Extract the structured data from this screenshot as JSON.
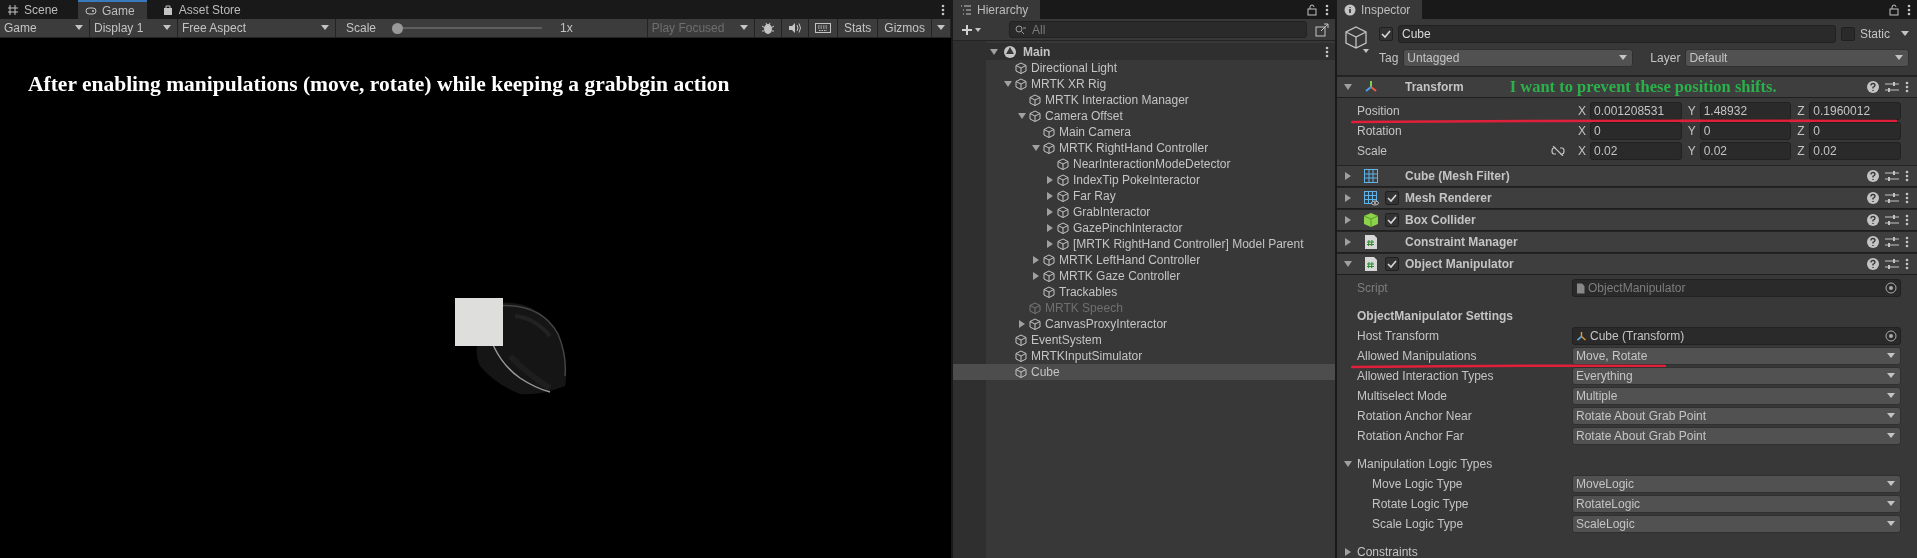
{
  "game_panel": {
    "tabs": [
      {
        "label": "Scene",
        "kind": "scene",
        "selected": false
      },
      {
        "label": "Game",
        "kind": "game",
        "selected": true
      },
      {
        "label": "Asset Store",
        "kind": "store",
        "selected": false
      }
    ],
    "toolbar": {
      "view_mode": "Game",
      "display": "Display 1",
      "aspect": "Free Aspect",
      "scale_label": "Scale",
      "scale_slider": {
        "level": 0
      },
      "scale_value": "1x",
      "play_mode": "Play Focused",
      "stats": "Stats",
      "gizmos": "Gizmos"
    },
    "annotation": "After enabling manipulations (move, rotate) while keeping a grabbgin action"
  },
  "hierarchy": {
    "title": "Hierarchy",
    "search_placeholder": "All",
    "scene": {
      "name": "Main",
      "expanded": true,
      "children": [
        {
          "name": "Directional Light",
          "selected": false,
          "inactive": false
        },
        {
          "name": "MRTK XR Rig",
          "expanded": true,
          "selected": false,
          "inactive": false,
          "children": [
            {
              "name": "MRTK Interaction Manager",
              "selected": false,
              "inactive": false
            },
            {
              "name": "Camera Offset",
              "expanded": true,
              "selected": false,
              "inactive": false,
              "children": [
                {
                  "name": "Main Camera",
                  "selected": false,
                  "inactive": false
                },
                {
                  "name": "MRTK RightHand Controller",
                  "expanded": true,
                  "selected": false,
                  "inactive": false,
                  "children": [
                    {
                      "name": "NearInteractionModeDetector",
                      "selected": false,
                      "inactive": false
                    },
                    {
                      "name": "IndexTip PokeInteractor",
                      "expanded": false,
                      "selected": false,
                      "inactive": false
                    },
                    {
                      "name": "Far Ray",
                      "expanded": false,
                      "selected": false,
                      "inactive": false
                    },
                    {
                      "name": "GrabInteractor",
                      "expanded": false,
                      "selected": false,
                      "inactive": false
                    },
                    {
                      "name": "GazePinchInteractor",
                      "expanded": false,
                      "selected": false,
                      "inactive": false
                    },
                    {
                      "name": "[MRTK RightHand Controller] Model Parent",
                      "expanded": false,
                      "selected": false,
                      "inactive": false
                    }
                  ]
                },
                {
                  "name": "MRTK LeftHand Controller",
                  "expanded": false,
                  "selected": false,
                  "inactive": false
                },
                {
                  "name": "MRTK Gaze Controller",
                  "expanded": false,
                  "selected": false,
                  "inactive": false
                },
                {
                  "name": "Trackables",
                  "selected": false,
                  "inactive": false
                }
              ]
            },
            {
              "name": "MRTK Speech",
              "selected": false,
              "inactive": true
            },
            {
              "name": "CanvasProxyInteractor",
              "expanded": false,
              "selected": false,
              "inactive": false
            }
          ]
        },
        {
          "name": "EventSystem",
          "selected": false,
          "inactive": false
        },
        {
          "name": "MRTKInputSimulator",
          "selected": false,
          "inactive": false
        },
        {
          "name": "Cube",
          "selected": true,
          "inactive": false
        }
      ]
    }
  },
  "inspector": {
    "title": "Inspector",
    "object": {
      "active": true,
      "name": "Cube",
      "static": false,
      "static_label": "Static",
      "tag_label": "Tag",
      "tag": "Untagged",
      "layer_label": "Layer",
      "layer": "Default"
    },
    "components": [
      {
        "kind": "transform",
        "name": "Transform",
        "expanded": true,
        "note": "I want to prevent these position shifts.",
        "rows": [
          {
            "label": "Position",
            "underlined": true,
            "values": [
              {
                "axis": "X",
                "value": "0.001208531"
              },
              {
                "axis": "Y",
                "value": "1.48932"
              },
              {
                "axis": "Z",
                "value": "0.1960012"
              }
            ]
          },
          {
            "label": "Rotation",
            "values": [
              {
                "axis": "X",
                "value": "0"
              },
              {
                "axis": "Y",
                "value": "0"
              },
              {
                "axis": "Z",
                "value": "0"
              }
            ]
          },
          {
            "label": "Scale",
            "constrain_icon": true,
            "values": [
              {
                "axis": "X",
                "value": "0.02"
              },
              {
                "axis": "Y",
                "value": "0.02"
              },
              {
                "axis": "Z",
                "value": "0.02"
              }
            ]
          }
        ]
      },
      {
        "kind": "mesh_filter",
        "name": "Cube (Mesh Filter)",
        "expanded": false
      },
      {
        "kind": "mesh_renderer",
        "name": "Mesh Renderer",
        "expanded": false,
        "enabled": true
      },
      {
        "kind": "box_collider",
        "name": "Box Collider",
        "expanded": false,
        "enabled": true
      },
      {
        "kind": "script",
        "name": "Constraint Manager",
        "expanded": false
      },
      {
        "kind": "script",
        "name": "Object Manipulator",
        "expanded": true,
        "enabled": true,
        "fields": [
          {
            "kind": "script",
            "label": "Script",
            "value": "ObjectManipulator"
          },
          {
            "kind": "header",
            "label": "ObjectManipulator Settings"
          },
          {
            "kind": "object",
            "label": "Host Transform",
            "value": "Cube (Transform)"
          },
          {
            "kind": "dropdown",
            "label": "Allowed Manipulations",
            "value": "Move, Rotate",
            "underlined": true
          },
          {
            "kind": "dropdown",
            "label": "Allowed Interaction Types",
            "value": "Everything"
          },
          {
            "kind": "dropdown",
            "label": "Multiselect Mode",
            "value": "Multiple"
          },
          {
            "kind": "dropdown",
            "label": "Rotation Anchor Near",
            "value": "Rotate About Grab Point"
          },
          {
            "kind": "dropdown",
            "label": "Rotation Anchor Far",
            "value": "Rotate About Grab Point"
          },
          {
            "kind": "foldout",
            "label": "Manipulation Logic Types",
            "expanded": true,
            "children": [
              {
                "kind": "dropdown",
                "label": "Move Logic Type",
                "value": "MoveLogic"
              },
              {
                "kind": "dropdown",
                "label": "Rotate Logic Type",
                "value": "RotateLogic"
              },
              {
                "kind": "dropdown",
                "label": "Scale Logic Type",
                "value": "ScaleLogic"
              }
            ]
          },
          {
            "kind": "foldout",
            "label": "Constraints",
            "expanded": false
          }
        ]
      }
    ]
  }
}
